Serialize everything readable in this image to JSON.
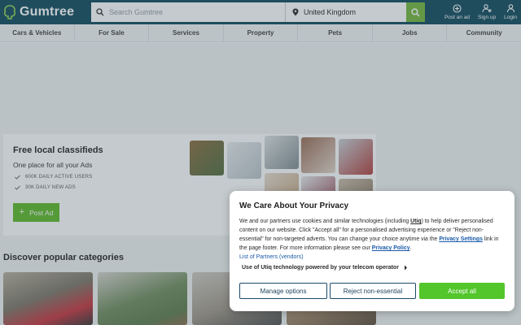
{
  "header": {
    "logo_text": "Gumtree",
    "search_placeholder": "Search Gumtree",
    "location_value": "United Kingdom",
    "actions": [
      {
        "label": "Post an ad",
        "icon": "plus-circle-icon"
      },
      {
        "label": "Sign up",
        "icon": "add-user-icon"
      },
      {
        "label": "Login",
        "icon": "user-icon"
      }
    ]
  },
  "nav": {
    "items": [
      "Cars & Vehicles",
      "For Sale",
      "Services",
      "Property",
      "Pets",
      "Jobs",
      "Community"
    ]
  },
  "hero": {
    "title": "Free local classifieds",
    "subtitle": "One place for all your Ads",
    "stats": [
      "600K DAILY ACTIVE USERS",
      "30K DAILY NEW ADS"
    ],
    "post_ad_label": "Post Ad"
  },
  "categories": {
    "title": "Discover popular categories"
  },
  "consent": {
    "title": "We Care About Your Privacy",
    "body_1": "We and our partners use cookies and similar technologies (including ",
    "body_utiq": "Utiq",
    "body_2": ") to help deliver personalised content on our website. Click \"Accept all\" for a personalised advertising experience or \"Reject non-essential\" for non-targeted adverts. You can change your choice anytime via the ",
    "body_settings_link": "Privacy Settings",
    "body_3": " link in the page footer. For more information please see our ",
    "body_policy_link": "Privacy Policy",
    "body_4": ".",
    "partners_link": "List of Partners (vendors)",
    "utiq_line": "Use of Utiq technology powered by your telecom operator",
    "manage_label": "Manage options",
    "reject_label": "Reject non-essential",
    "accept_label": "Accept all"
  },
  "colors": {
    "brand_header": "#0d475c",
    "search_button": "#72b63a",
    "accept_button": "#52c62b",
    "post_ad_button": "#5cb825",
    "link": "#1a5aa8"
  }
}
